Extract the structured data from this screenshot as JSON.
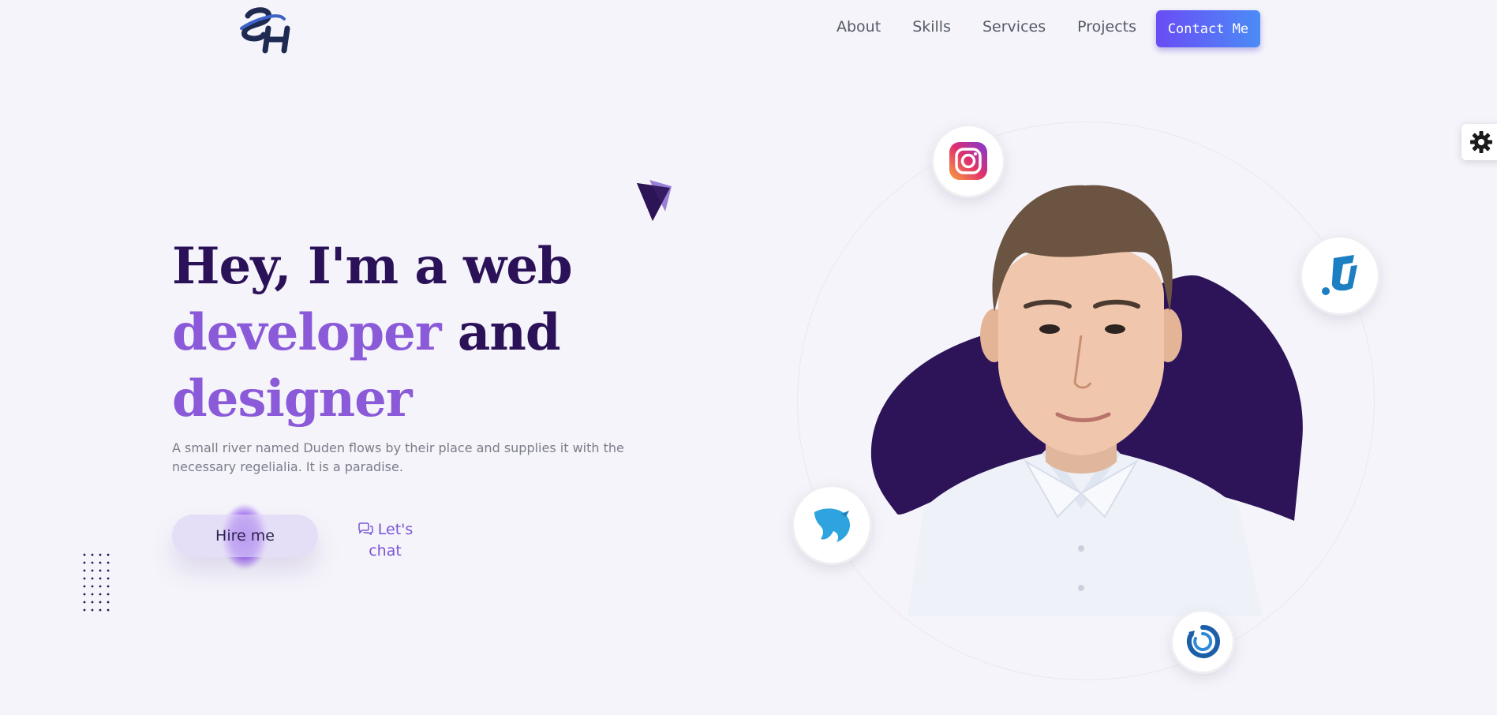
{
  "header": {
    "logo_name": "sh-logo",
    "nav": [
      "About",
      "Skills",
      "Services",
      "Projects"
    ],
    "contact_label": "Contact Me"
  },
  "hero": {
    "line1": "Hey, I'm a web",
    "line2_accent": "developer",
    "line2_dark": "and",
    "line3_accent": "designer",
    "subtitle": "A small river named Duden flows by their place and supplies it with the necessary regelialia. It is a paradise.",
    "hire_label": "Hire me",
    "chat_label": "Let's chat"
  },
  "social_badges": [
    "instagram-icon",
    "u-logo-icon",
    "bird-icon",
    "ring-logo-icon"
  ],
  "colors": {
    "background": "#f5f4fa",
    "heading_dark": "#2b1258",
    "heading_accent": "#8a5ad8",
    "blob": "#2d1458",
    "button_gradient_start": "#6a4cf5",
    "button_gradient_end": "#4b8cf6"
  }
}
